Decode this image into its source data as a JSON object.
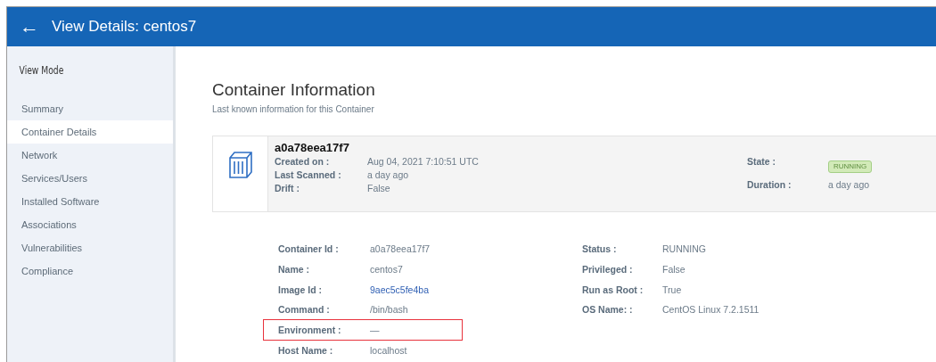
{
  "header": {
    "back_icon": "←",
    "title": "View Details: centos7"
  },
  "sidebar": {
    "heading": "View Mode",
    "items": [
      {
        "label": "Summary",
        "selected": false
      },
      {
        "label": "Container Details",
        "selected": true
      },
      {
        "label": "Network",
        "selected": false
      },
      {
        "label": "Services/Users",
        "selected": false
      },
      {
        "label": "Installed Software",
        "selected": false
      },
      {
        "label": "Associations",
        "selected": false
      },
      {
        "label": "Vulnerabilities",
        "selected": false
      },
      {
        "label": "Compliance",
        "selected": false
      }
    ]
  },
  "main": {
    "title": "Container Information",
    "subtitle": "Last known information for this Container",
    "card": {
      "name": "a0a78eea17f7",
      "left": [
        {
          "label": "Created on :",
          "value": "Aug 04, 2021 7:10:51 UTC"
        },
        {
          "label": "Last Scanned :",
          "value": "a day ago"
        },
        {
          "label": "Drift :",
          "value": "False"
        }
      ],
      "right": [
        {
          "label": "State :",
          "value": "RUNNING",
          "kind": "badge"
        },
        {
          "label": "Duration :",
          "value": "a day ago",
          "kind": "text"
        }
      ]
    },
    "details_left": [
      {
        "label": "Container Id :",
        "value": "a0a78eea17f7",
        "kind": "text",
        "highlighted": false
      },
      {
        "label": "Name :",
        "value": "centos7",
        "kind": "text",
        "highlighted": false
      },
      {
        "label": "Image Id :",
        "value": "9aec5c5fe4ba",
        "kind": "link",
        "highlighted": false
      },
      {
        "label": "Command :",
        "value": "/bin/bash",
        "kind": "text",
        "highlighted": false
      },
      {
        "label": "Environment :",
        "value": "—",
        "kind": "text",
        "highlighted": true
      },
      {
        "label": "Host Name :",
        "value": "localhost",
        "kind": "text",
        "highlighted": false
      }
    ],
    "details_right": [
      {
        "label": "Status :",
        "value": "RUNNING"
      },
      {
        "label": "Privileged :",
        "value": "False"
      },
      {
        "label": "Run as Root :",
        "value": "True"
      },
      {
        "label": "OS Name: :",
        "value": "CentOS Linux 7.2.1511"
      }
    ]
  }
}
